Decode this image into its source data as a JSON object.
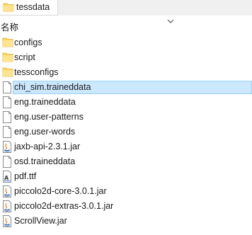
{
  "tab": {
    "title": "tessdata",
    "icon": "folder-icon"
  },
  "header": {
    "name_column": "名称",
    "sort_icon": "chevron-down-icon"
  },
  "files": [
    {
      "name": "configs",
      "type": "folder",
      "icon": "folder-icon"
    },
    {
      "name": "script",
      "type": "folder",
      "icon": "folder-icon"
    },
    {
      "name": "tessconfigs",
      "type": "folder",
      "icon": "folder-icon"
    },
    {
      "name": "chi_sim.traineddata",
      "type": "file",
      "icon": "file-icon",
      "selected": true
    },
    {
      "name": "eng.traineddata",
      "type": "file",
      "icon": "file-icon"
    },
    {
      "name": "eng.user-patterns",
      "type": "file",
      "icon": "file-icon"
    },
    {
      "name": "eng.user-words",
      "type": "file",
      "icon": "file-icon"
    },
    {
      "name": "jaxb-api-2.3.1.jar",
      "type": "jar",
      "icon": "jar-file-icon"
    },
    {
      "name": "osd.traineddata",
      "type": "file",
      "icon": "file-icon"
    },
    {
      "name": "pdf.ttf",
      "type": "font",
      "icon": "font-file-icon"
    },
    {
      "name": "piccolo2d-core-3.0.1.jar",
      "type": "jar",
      "icon": "jar-file-icon"
    },
    {
      "name": "piccolo2d-extras-3.0.1.jar",
      "type": "jar",
      "icon": "jar-file-icon"
    },
    {
      "name": "ScrollView.jar",
      "type": "jar",
      "icon": "jar-file-icon"
    }
  ],
  "colors": {
    "selection_fill": "#cce8ff",
    "selection_border": "#99d1ff",
    "folder": "#ffd75e"
  }
}
